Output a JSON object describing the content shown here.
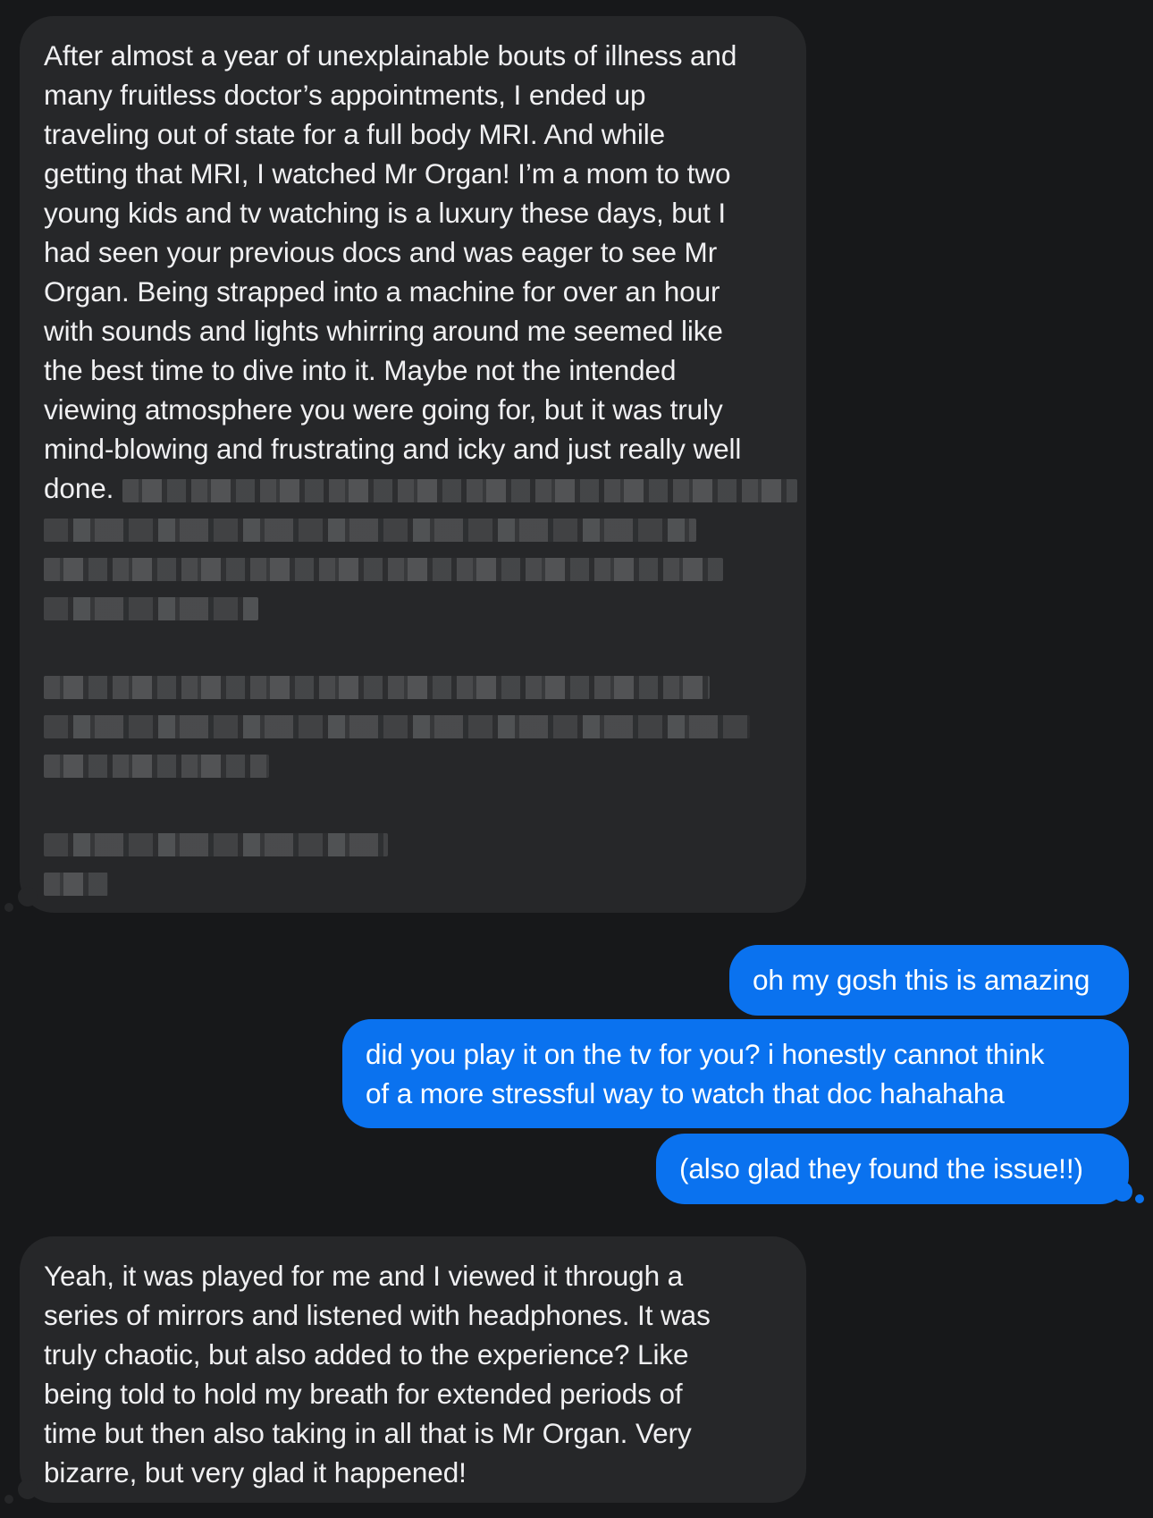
{
  "conversation": {
    "messages": [
      {
        "direction": "incoming",
        "lines": [
          "After almost a year of unexplainable bouts of illness and",
          "many fruitless doctor’s appointments, I ended up",
          "traveling out of state for a full body MRI. And while",
          "getting that MRI, I watched Mr Organ! I’m a mom to two",
          "young kids and tv watching is a luxury these days, but I",
          "had seen your previous docs and was eager to see Mr",
          "Organ. Being strapped into a machine for over an hour",
          "with sounds and lights whirring around me seemed like",
          "the best time to dive into it. Maybe not the intended",
          "viewing atmosphere you were going for, but it was truly",
          "mind-blowing and frustrating and icky and just really well",
          "done."
        ]
      },
      {
        "direction": "outgoing",
        "lines": [
          "oh my gosh this is amazing"
        ]
      },
      {
        "direction": "outgoing",
        "lines": [
          "did you play it on the tv for you? i honestly cannot think",
          "of a more stressful way to watch that doc hahahaha"
        ]
      },
      {
        "direction": "outgoing",
        "lines": [
          "(also glad they found the issue!!)"
        ]
      },
      {
        "direction": "incoming",
        "lines": [
          "Yeah, it was played for me and I viewed it through a",
          "series of mirrors and listened with headphones. It was",
          "truly chaotic, but also added to the experience? Like",
          "being told to hold my breath for extended periods of",
          "time but then also taking in all that is Mr Organ. Very",
          "bizarre, but very glad it happened!"
        ]
      }
    ]
  },
  "colors": {
    "background": "#17181a",
    "incoming_bubble": "#262729",
    "outgoing_bubble": "#0a72ef",
    "incoming_text": "#f0f0f2",
    "outgoing_text": "#ffffff"
  }
}
